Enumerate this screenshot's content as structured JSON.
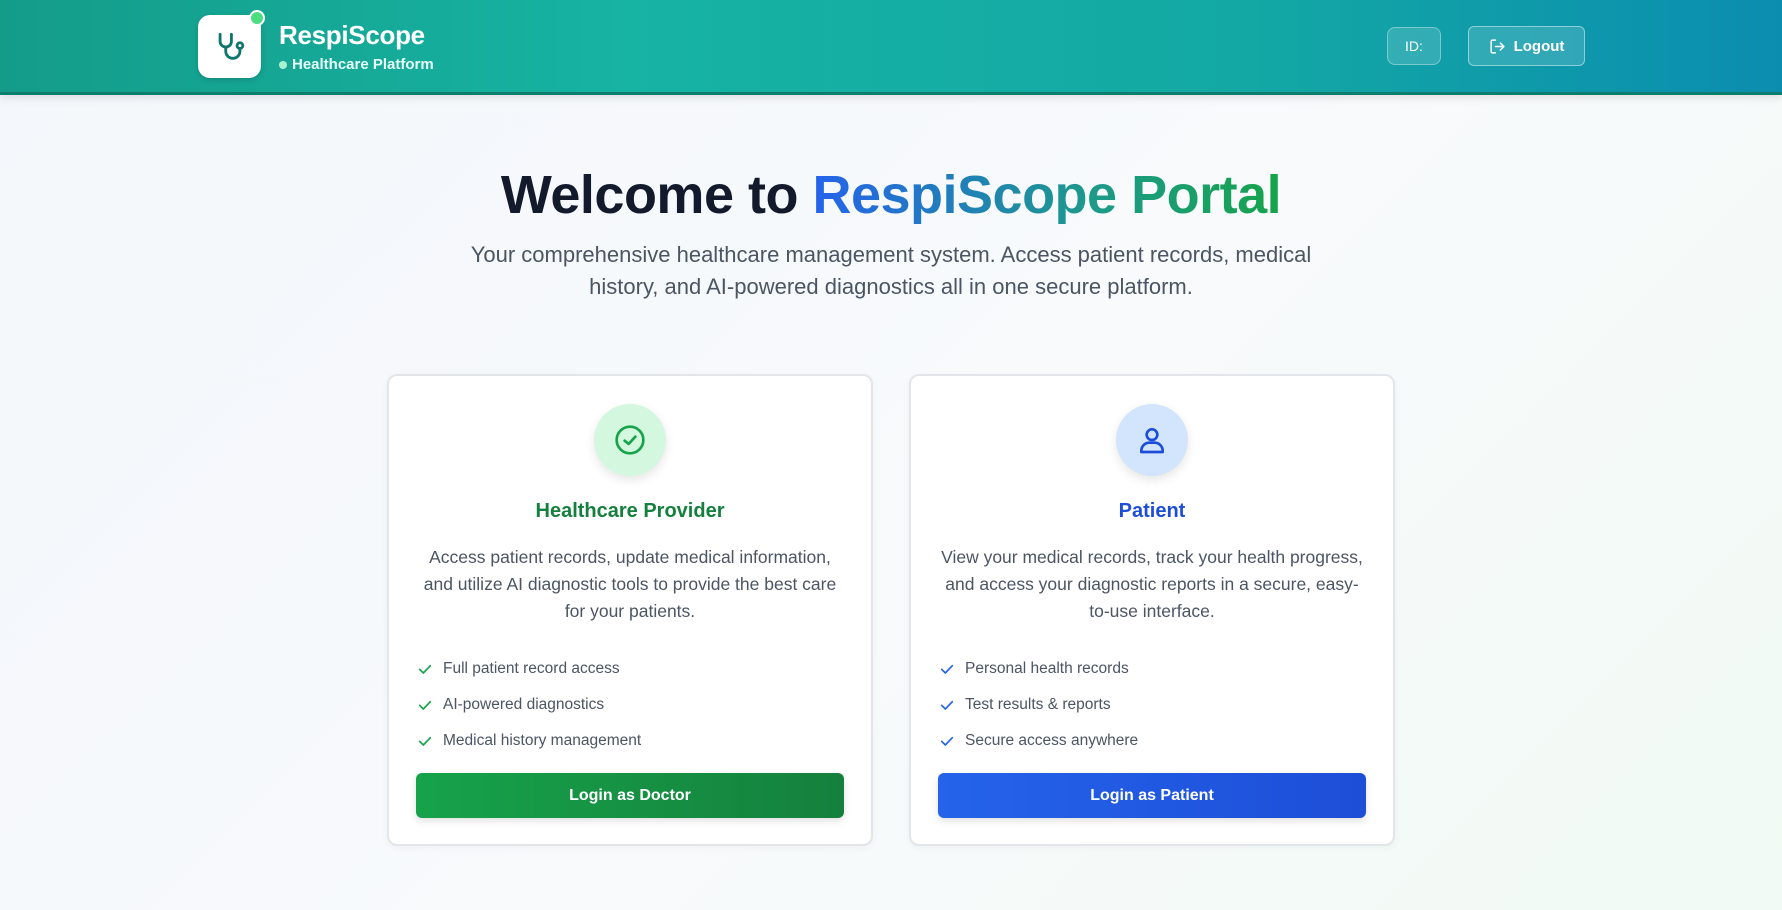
{
  "header": {
    "brand_name": "RespiScope",
    "brand_subtitle": "Healthcare Platform",
    "id_label": "ID:",
    "logout_label": "Logout",
    "logo_icon": "stethoscope-icon",
    "status_dot_color": "#4ade80"
  },
  "hero": {
    "title_prefix": "Welcome to",
    "title_highlight": "RespiScope Portal",
    "subtitle": "Your comprehensive healthcare management system. Access patient records, medical history, and AI-powered diagnostics all in one secure platform."
  },
  "cards": [
    {
      "icon": "check-circle-icon",
      "title": "Healthcare Provider",
      "description": "Access patient records, update medical information, and utilize AI diagnostic tools to provide the best care for your patients.",
      "features": [
        "Full patient record access",
        "AI-powered diagnostics",
        "Medical history management"
      ],
      "button_label": "Login as Doctor",
      "accent": "#16a34a"
    },
    {
      "icon": "user-icon",
      "title": "Patient",
      "description": "View your medical records, track your health progress, and access your diagnostic reports in a secure, easy-to-use interface.",
      "features": [
        "Personal health records",
        "Test results & reports",
        "Secure access anywhere"
      ],
      "button_label": "Login as Patient",
      "accent": "#2563eb"
    }
  ]
}
